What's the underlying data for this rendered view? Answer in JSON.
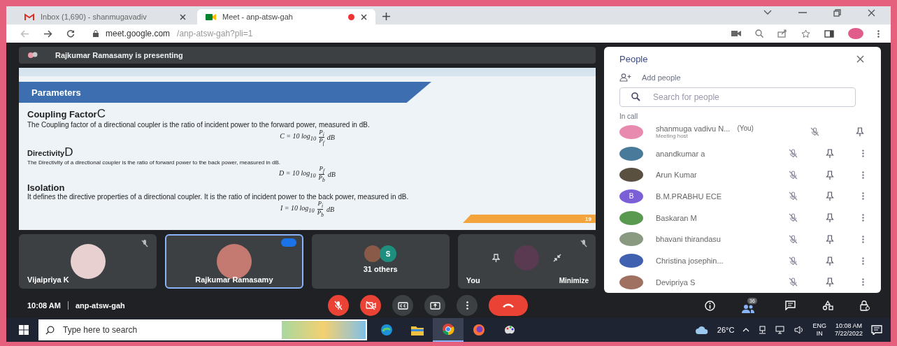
{
  "browser": {
    "tabs": [
      {
        "kind": "mail",
        "title": "Inbox (1,690) - shanmugavadiv",
        "selected": false
      },
      {
        "kind": "meet",
        "title": "Meet - anp-atsw-gah",
        "selected": true,
        "recording": true
      }
    ],
    "url_host": "meet.google.com",
    "url_path": "/anp-atsw-gah?pli=1"
  },
  "presenting": {
    "text": "Rajkumar Ramasamy is presenting"
  },
  "slide": {
    "banner": "Parameters",
    "page": "19",
    "sections": [
      {
        "title": "Coupling Factor",
        "symbol": "C",
        "text": "The Coupling factor of a directional coupler is the ratio of incident power to the forward power, measured in dB.",
        "formula": {
          "lhs": "C = 10 log$_{10}$",
          "num": "P$_{i}$",
          "den": "P$_{f}$",
          "unit": "dB"
        },
        "kind": "main"
      },
      {
        "title": "Directivity",
        "symbol": "D",
        "text": "The Directivity of a directional coupler is the ratio of forward power to the back power, measured in dB.",
        "formula": {
          "lhs": "D = 10 log$_{10}$",
          "num": "P$_{f}$",
          "den": "P$_{b}$",
          "unit": "dB"
        },
        "kind": "minor"
      },
      {
        "title": "Isolation",
        "text": "It defines the directive properties of a directional coupler. It is the ratio of incident power to the back power, measured in dB.",
        "formula": {
          "lhs": "I = 10 log$_{10}$",
          "num": "P$_{i}$",
          "den": "P$_{b}$",
          "unit": "dB"
        },
        "kind": "main"
      }
    ]
  },
  "tiles": [
    {
      "kind": "person",
      "name": "Vijaipriya K",
      "muted": true,
      "speaking": false,
      "color": "#e8d0d0"
    },
    {
      "kind": "person",
      "name": "Rajkumar Ramasamy",
      "muted": false,
      "speaking": true,
      "color": "#c47a70"
    },
    {
      "kind": "others",
      "label": "31 others",
      "letter": "S",
      "color": "#1e8e7e"
    },
    {
      "kind": "self",
      "name": "You",
      "muted": true,
      "speaking": false,
      "action": "Minimize",
      "color": "#5a3a50"
    }
  ],
  "meeting": {
    "time": "10:08 AM",
    "code": "anp-atsw-gah"
  },
  "controls": [
    {
      "kind": "mic",
      "on": false
    },
    {
      "kind": "camera",
      "on": false
    },
    {
      "kind": "captions"
    },
    {
      "kind": "present"
    },
    {
      "kind": "more"
    },
    {
      "kind": "hangup"
    }
  ],
  "side_controls": [
    {
      "kind": "info"
    },
    {
      "kind": "people",
      "badge": "36"
    },
    {
      "kind": "chat"
    },
    {
      "kind": "activities"
    },
    {
      "kind": "lock"
    }
  ],
  "people": {
    "title": "People",
    "add": "Add people",
    "search_placeholder": "Search for people",
    "section": "In call",
    "rows": [
      {
        "kind": "host",
        "name": "shanmuga vadivu N...",
        "tag": "(You)",
        "role": "Meeting host",
        "color": "#e88ab0"
      },
      {
        "kind": "guest",
        "name": "anandkumar a",
        "color": "#4a7a9a"
      },
      {
        "kind": "guest",
        "name": "Arun Kumar",
        "color": "#5a5040"
      },
      {
        "kind": "guest",
        "name": "B.M.PRABHU ECE",
        "letter": "B",
        "color": "#7b5fd6"
      },
      {
        "kind": "guest",
        "name": "Baskaran M",
        "color": "#5a9a50"
      },
      {
        "kind": "guest",
        "name": "bhavani thirandasu",
        "color": "#8a9a80"
      },
      {
        "kind": "guest",
        "name": "Christina josephin...",
        "color": "#4060b0"
      },
      {
        "kind": "guest",
        "name": "Devipriya S",
        "color": "#a07060"
      }
    ]
  },
  "taskbar": {
    "search_placeholder": "Type here to search",
    "apps": [
      {
        "kind": "edge",
        "selected": false
      },
      {
        "kind": "folder",
        "selected": false
      },
      {
        "kind": "chrome",
        "selected": true
      },
      {
        "kind": "firefox",
        "selected": false
      },
      {
        "kind": "paint",
        "selected": false
      }
    ],
    "temperature": "26°C",
    "lang": "ENG",
    "region": "IN",
    "time": "10:08 AM",
    "date": "7/22/2022"
  }
}
